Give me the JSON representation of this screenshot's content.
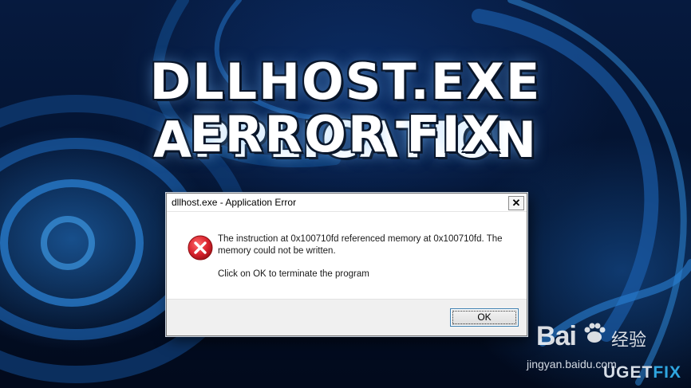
{
  "headline": {
    "line1": "DLLHOST.EXE APPLICATION",
    "line2": "ERROR FIX"
  },
  "dialog": {
    "title": "dllhost.exe - Application Error",
    "close_glyph": "✕",
    "icon": "error-icon",
    "message_line1": "The instruction at 0x100710fd referenced memory at 0x100710fd. The memory could not be written.",
    "message_line2": "Click on OK to terminate the program",
    "ok_label": "OK"
  },
  "watermarks": {
    "baidu_logo": "Bai",
    "baidu_cn": "经验",
    "jingyan_url": "jingyan.baidu.com",
    "uget": "UG",
    "uget_e": "E",
    "uget_t": "T",
    "fix": "FIX"
  },
  "colors": {
    "background": "#04122e",
    "accent": "#2fa6e0",
    "error_red": "#d9232e"
  }
}
